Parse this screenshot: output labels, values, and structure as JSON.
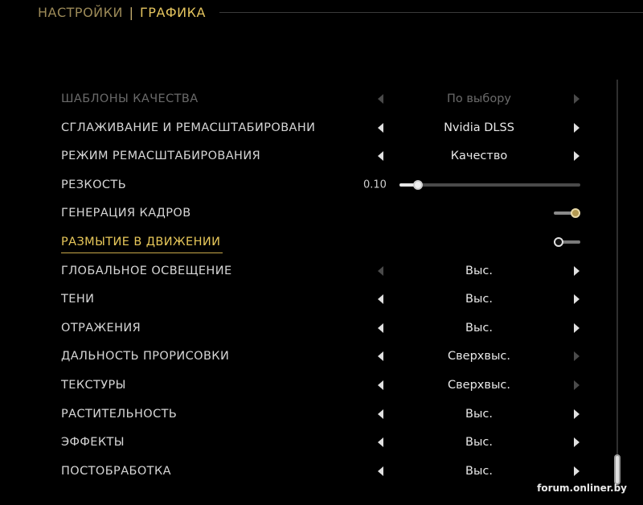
{
  "header": {
    "parent": "НАСТРОЙКИ",
    "separator": "|",
    "current": "ГРАФИКА"
  },
  "settings": [
    {
      "label": "ШАБЛОНЫ КАЧЕСТВА",
      "type": "selector",
      "value": "По выбору",
      "disabled": true,
      "left_enabled": false,
      "right_enabled": false
    },
    {
      "label": "СГЛАЖИВАНИЕ И РЕМАСШТАБИРОВАНИ",
      "type": "selector",
      "value": "Nvidia DLSS",
      "left_enabled": true,
      "right_enabled": true
    },
    {
      "label": "РЕЖИМ РЕМАСШТАБИРОВАНИЯ",
      "type": "selector",
      "value": "Качество",
      "left_enabled": true,
      "right_enabled": true
    },
    {
      "label": "РЕЗКОСТЬ",
      "type": "slider",
      "value_text": "0.10",
      "fraction": 0.1
    },
    {
      "label": "ГЕНЕРАЦИЯ КАДРОВ",
      "type": "toggle",
      "on": true
    },
    {
      "label": "РАЗМЫТИЕ В ДВИЖЕНИИ",
      "type": "toggle",
      "on": false,
      "active": true
    },
    {
      "label": "ГЛОБАЛЬНОЕ ОСВЕЩЕНИЕ",
      "type": "selector",
      "value": "Выс.",
      "left_enabled": false,
      "right_enabled": true
    },
    {
      "label": "ТЕНИ",
      "type": "selector",
      "value": "Выс.",
      "left_enabled": true,
      "right_enabled": true
    },
    {
      "label": "ОТРАЖЕНИЯ",
      "type": "selector",
      "value": "Выс.",
      "left_enabled": true,
      "right_enabled": true
    },
    {
      "label": "ДАЛЬНОСТЬ ПРОРИСОВКИ",
      "type": "selector",
      "value": "Сверхвыс.",
      "left_enabled": true,
      "right_enabled": false
    },
    {
      "label": "ТЕКСТУРЫ",
      "type": "selector",
      "value": "Сверхвыс.",
      "left_enabled": true,
      "right_enabled": false
    },
    {
      "label": "РАСТИТЕЛЬНОСТЬ",
      "type": "selector",
      "value": "Выс.",
      "left_enabled": true,
      "right_enabled": true
    },
    {
      "label": "ЭФФЕКТЫ",
      "type": "selector",
      "value": "Выс.",
      "left_enabled": true,
      "right_enabled": true
    },
    {
      "label": "ПОСТОБРАБОТКА",
      "type": "selector",
      "value": "Выс.",
      "left_enabled": true,
      "right_enabled": true
    }
  ],
  "watermark": "forum.onliner.by",
  "colors": {
    "accent": "#e8c85a",
    "breadcrumb_parent": "#9c8a58",
    "background": "#000000"
  }
}
